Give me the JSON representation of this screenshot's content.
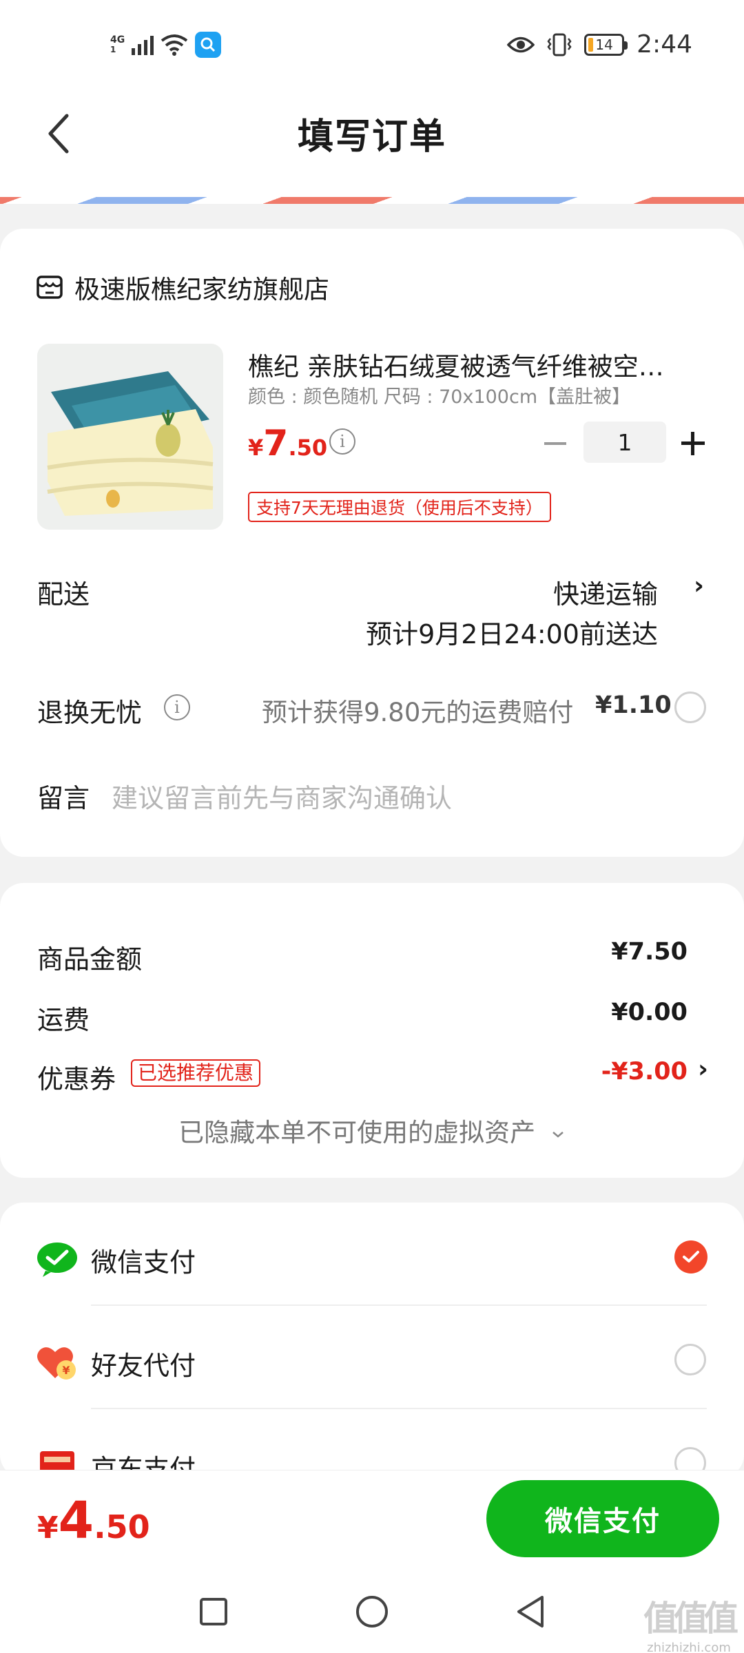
{
  "status_bar": {
    "network": "4G",
    "time": "2:44",
    "battery": "14"
  },
  "header": {
    "title": "填写订单"
  },
  "shop": {
    "name": "极速版樵纪家纺旗舰店"
  },
  "product": {
    "title": "樵纪 亲肤钻石绒夏被透气纤维被空调被",
    "spec": "颜色 : 颜色随机   尺码 : 70x100cm【盖肚被】",
    "price_currency": "¥",
    "price_int": "7",
    "price_dec": ".50",
    "quantity": "1",
    "return_policy": "支持7天无理由退货（使用后不支持）"
  },
  "delivery": {
    "label": "配送",
    "method": "快递运输",
    "eta": "预计9月2日24:00前送达"
  },
  "worry_free": {
    "label": "退换无忧",
    "description": "预计获得9.80元的运费赔付",
    "price": "¥1.10",
    "selected": false
  },
  "message": {
    "label": "留言",
    "placeholder": "建议留言前先与商家沟通确认"
  },
  "summary": {
    "goods_label": "商品金额",
    "goods_value": "¥7.50",
    "shipping_label": "运费",
    "shipping_value": "¥0.00",
    "coupon_label": "优惠券",
    "coupon_tag": "已选推荐优惠",
    "coupon_value": "-¥3.00",
    "hidden_assets": "已隐藏本单不可使用的虚拟资产"
  },
  "payment_methods": [
    {
      "label": "微信支付",
      "icon": "wechat-pay-icon",
      "selected": true
    },
    {
      "label": "好友代付",
      "icon": "friend-pay-icon",
      "selected": false
    },
    {
      "label": "京东支付",
      "icon": "jd-pay-icon",
      "selected": false
    }
  ],
  "bottom": {
    "total_currency": "¥",
    "total_int": "4",
    "total_dec": ".50",
    "pay_button": "微信支付"
  },
  "watermark": {
    "mark": "值值值",
    "text": "zhizhizhi.com"
  },
  "colors": {
    "accent_red": "#e2231a",
    "wechat_green": "#10b51c",
    "selected_orange": "#f2462a"
  }
}
